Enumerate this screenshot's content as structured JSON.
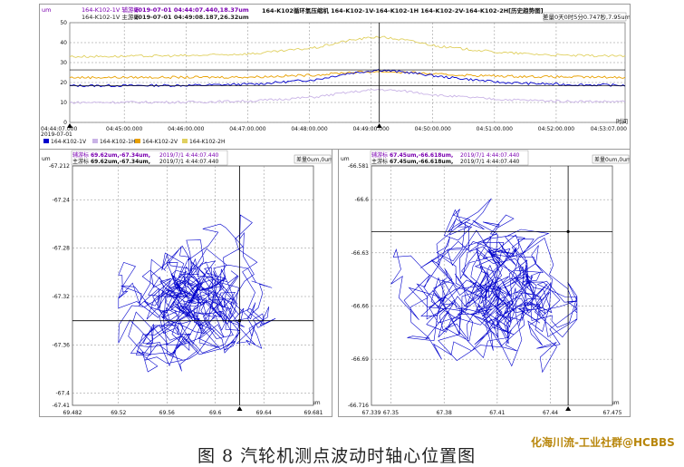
{
  "colors": {
    "v1": "#0000cc",
    "h1": "#c9b3e6",
    "v2": "#e8a000",
    "h2": "#e0d060",
    "cursor": "#000000",
    "aux": "#7a00b0",
    "grid": "#8a8a8a"
  },
  "top_panel": {
    "title": "164-K102循环氢压缩机 164-K102-1V-164-K102-1H 164-K102-2V-164-K102-2H[历史趋势图]",
    "unit": "um",
    "aux_cursor_prefix": "164-K102-1V 辅游标",
    "aux_cursor_value": "2019-07-01 04:44:07.440,18.37um",
    "main_cursor_prefix": "164-K102-1V 主游标",
    "main_cursor_value": "2019-07-01 04:49:08.187,26.32um",
    "diff_label": "差量0天0时5分0.747秒,7.95um",
    "time_axis_unit": "时间",
    "first_date": "2019-07-01",
    "legend": [
      "164-K102-1V",
      "164-K102-1H",
      "164-K102-2V",
      "164-K102-2H"
    ]
  },
  "left_panel": {
    "aux_line_a": "辅游标",
    "aux_line_b": "69.62um,-67.34um,",
    "aux_line_c": "2019/7/1 4:44:07.440",
    "main_line_a": "主游标",
    "main_line_b": "69.62um,-67.34um,",
    "main_line_c": "2019/7/1 4:44:07.440",
    "diff_label": "差量0um,0um",
    "unit": "um"
  },
  "right_panel": {
    "aux_line_a": "辅游标",
    "aux_line_b": "67.45um,-66.618um,",
    "aux_line_c": "2019/7/1 4:44:07.440",
    "main_line_a": "主游标",
    "main_line_b": "67.45um,-66.618um,",
    "main_line_c": "2019/7/1 4:44:07.440",
    "diff_label": "差量0um,0um",
    "unit": "um"
  },
  "caption": "图 8   汽轮机测点波动时轴心位置图",
  "watermark": "化海川流-工业社群@HCBBS",
  "chart_data": [
    {
      "type": "line",
      "title": "164-K102循环氢压缩机 164-K102-1V-164-K102-1H 164-K102-2V-164-K102-2H[历史趋势图]",
      "xlabel": "时间",
      "ylabel": "um",
      "ylim": [
        0,
        50
      ],
      "yticks": [
        0,
        10,
        20,
        30,
        40,
        50
      ],
      "xticks": [
        "04:44:07.000",
        "04:45:00.000",
        "04:46:00.000",
        "04:47:00.000",
        "04:48:00.000",
        "04:49:00.000",
        "04:50:00.000",
        "04:51:00.000",
        "04:52:00.000",
        "04:53:07.000"
      ],
      "x_seconds": [
        0,
        60,
        120,
        180,
        240,
        270,
        300,
        330,
        360,
        420,
        480,
        540
      ],
      "series": [
        {
          "name": "164-K102-1V",
          "color": "#0000cc",
          "values": [
            18.4,
            18.5,
            18.6,
            19.2,
            21.5,
            24.5,
            26.3,
            25.0,
            23.0,
            20.0,
            19.0,
            18.6
          ]
        },
        {
          "name": "164-K102-1H",
          "color": "#c9b3e6",
          "values": [
            10.0,
            10.1,
            10.2,
            10.8,
            12.8,
            15.0,
            16.5,
            15.5,
            13.5,
            11.5,
            10.6,
            10.4
          ]
        },
        {
          "name": "164-K102-2V",
          "color": "#e8a000",
          "values": [
            22.5,
            22.6,
            22.6,
            22.8,
            23.8,
            25.0,
            25.5,
            25.0,
            24.0,
            23.2,
            22.8,
            22.6
          ]
        },
        {
          "name": "164-K102-2H",
          "color": "#e0d060",
          "values": [
            33.0,
            33.2,
            33.5,
            34.5,
            37.5,
            41.0,
            43.0,
            41.0,
            38.0,
            35.0,
            33.6,
            33.2
          ]
        }
      ],
      "cursor_main_seconds": 301,
      "cursor_aux_seconds": 0,
      "grid": true
    },
    {
      "type": "scatter",
      "xlim": [
        69.482,
        69.681
      ],
      "ylim": [
        -67.41,
        -67.212
      ],
      "xticks": [
        69.482,
        69.52,
        69.56,
        69.6,
        69.64,
        69.681
      ],
      "yticks": [
        -67.212,
        -67.24,
        -67.28,
        -67.32,
        -67.36,
        -67.4,
        -67.41
      ],
      "xlabel": "um",
      "ylabel": "um",
      "cursor": [
        69.62,
        -67.34
      ],
      "cluster": {
        "x": [
          69.52,
          69.65
        ],
        "y": [
          -67.385,
          -67.245
        ]
      },
      "grid": true
    },
    {
      "type": "scatter",
      "xlim": [
        67.339,
        67.475
      ],
      "ylim": [
        -66.716,
        -66.581
      ],
      "xticks": [
        67.339,
        67.35,
        67.38,
        67.41,
        67.44,
        67.475
      ],
      "yticks": [
        -66.581,
        -66.6,
        -66.63,
        -66.66,
        -66.69,
        -66.716
      ],
      "xlabel": "um",
      "ylabel": "um",
      "cursor": [
        67.45,
        -66.618
      ],
      "cluster": {
        "x": [
          67.35,
          67.455
        ],
        "y": [
          -66.705,
          -66.598
        ]
      },
      "grid": true
    }
  ]
}
